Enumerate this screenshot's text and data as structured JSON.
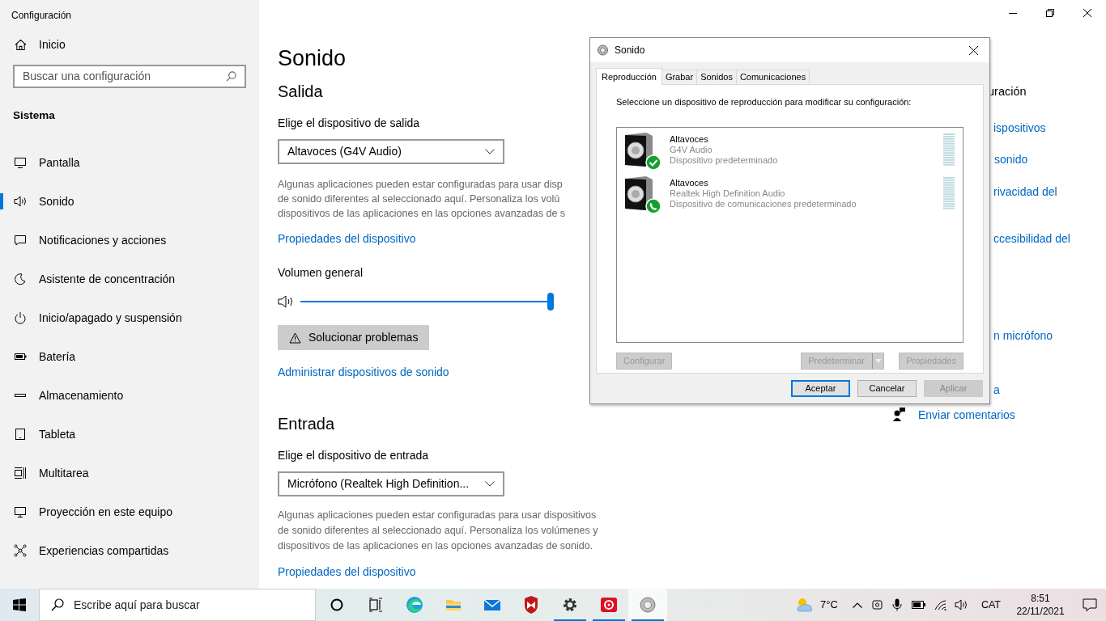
{
  "window": {
    "title": "Configuración"
  },
  "sidebar": {
    "home": "Inicio",
    "search": {
      "placeholder": "Buscar una configuración"
    },
    "section": "Sistema",
    "items": [
      {
        "label": "Pantalla",
        "selected": false
      },
      {
        "label": "Sonido",
        "selected": true
      },
      {
        "label": "Notificaciones y acciones",
        "selected": false
      },
      {
        "label": "Asistente de concentración",
        "selected": false
      },
      {
        "label": "Inicio/apagado y suspensión",
        "selected": false
      },
      {
        "label": "Batería",
        "selected": false
      },
      {
        "label": "Almacenamiento",
        "selected": false
      },
      {
        "label": "Tableta",
        "selected": false
      },
      {
        "label": "Multitarea",
        "selected": false
      },
      {
        "label": "Proyección en este equipo",
        "selected": false
      },
      {
        "label": "Experiencias compartidas",
        "selected": false
      }
    ]
  },
  "main": {
    "title": "Sonido",
    "output": {
      "heading": "Salida",
      "label": "Elige el dispositivo de salida",
      "device": "Altavoces (G4V Audio)",
      "description_lines": [
        "Algunas aplicaciones pueden estar configuradas para usar disp",
        "de sonido diferentes al seleccionado aquí. Personaliza los volú",
        "dispositivos de las aplicaciones en las opciones avanzadas de s"
      ],
      "link": "Propiedades del dispositivo",
      "volume_label": "Volumen general",
      "volume": {
        "level": 1
      },
      "troubleshoot_button": "Solucionar problemas",
      "manage_link": "Administrar dispositivos de sonido"
    },
    "input": {
      "heading": "Entrada",
      "label": "Elige el dispositivo de entrada",
      "device": "Micrófono (Realtek High Definition...",
      "description_lines": [
        "Algunas aplicaciones pueden estar configuradas para usar dispositivos",
        "de sonido diferentes al seleccionado aquí. Personaliza los volúmenes y",
        "dispositivos de las aplicaciones en las opciones avanzadas de sonido."
      ],
      "link": "Propiedades del dispositivo"
    }
  },
  "related": {
    "title": "uración",
    "links": [
      "ispositivos",
      "sonido",
      "rivacidad del",
      "ccesibilidad del",
      "n micrófono",
      "a"
    ],
    "feedback": "Enviar comentarios"
  },
  "sound_dialog": {
    "title": "Sonido",
    "tabs": [
      {
        "label": "Reproducción",
        "selected": true
      },
      {
        "label": "Grabar",
        "selected": false
      },
      {
        "label": "Sonidos",
        "selected": false
      },
      {
        "label": "Comunicaciones",
        "selected": false
      }
    ],
    "instruction": "Seleccione un dispositivo de reproducción para modificar su configuración:",
    "devices": [
      {
        "name": "Altavoces",
        "driver": "G4V Audio",
        "status": "Dispositivo predeterminado",
        "kind": "default"
      },
      {
        "name": "Altavoces",
        "driver": "Realtek High Definition Audio",
        "status": "Dispositivo de comunicaciones predeterminado",
        "kind": "communications"
      }
    ],
    "panel_buttons": [
      {
        "label": "Configurar",
        "disabled": true,
        "kind": "plain"
      },
      {
        "label": "Predeterminar",
        "disabled": true,
        "kind": "split"
      },
      {
        "label": "Propiedades",
        "disabled": true,
        "kind": "plain"
      }
    ],
    "buttons": [
      {
        "label": "Aceptar",
        "disabled": false,
        "default": true
      },
      {
        "label": "Cancelar",
        "disabled": false,
        "default": false
      },
      {
        "label": "Aplicar",
        "disabled": true,
        "default": false
      }
    ]
  },
  "taskbar": {
    "search": {
      "placeholder": "Escribe aquí para buscar"
    },
    "apps": [
      {
        "running": false,
        "active": false
      },
      {
        "running": false,
        "active": false
      },
      {
        "running": false,
        "active": false
      },
      {
        "running": false,
        "active": false
      },
      {
        "running": false,
        "active": false
      },
      {
        "running": false,
        "active": false
      },
      {
        "running": true,
        "active": false
      },
      {
        "running": true,
        "active": false
      },
      {
        "running": true,
        "active": true
      }
    ],
    "temperature": "7°C",
    "language": "CAT",
    "time": "8:51",
    "date": "22/11/2021"
  }
}
